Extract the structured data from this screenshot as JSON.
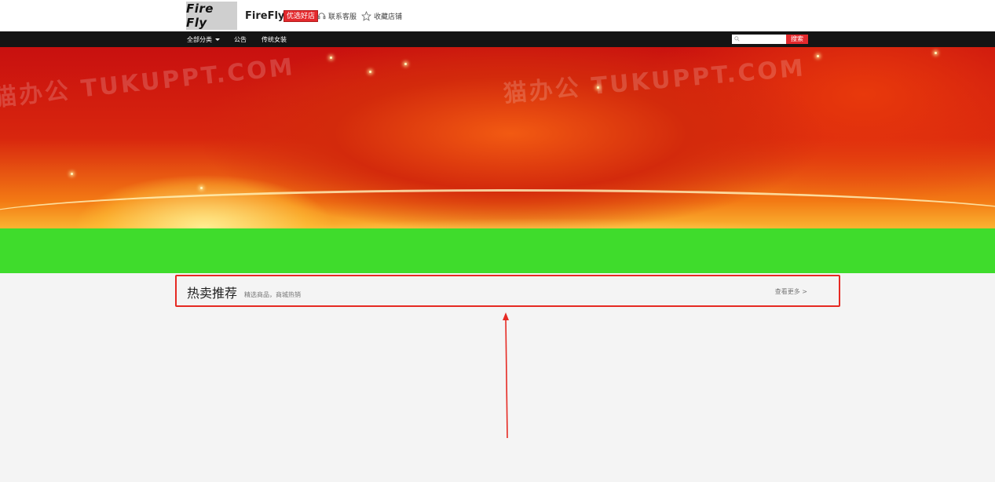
{
  "header": {
    "logo_text": "Fire Fly",
    "store_name": "FireFly",
    "badge": "优选好店",
    "contact_label": "联系客服",
    "favorite_label": "收藏店铺"
  },
  "nav": {
    "items": [
      {
        "label": "全部分类"
      },
      {
        "label": "公告"
      },
      {
        "label": "传统女装"
      }
    ],
    "search_placeholder": "",
    "search_button": "搜索"
  },
  "banner": {
    "watermark_left": "猫办公 TUKUPPT.COM",
    "watermark_right": "猫办公 TUKUPPT.COM"
  },
  "hot_section": {
    "title": "热卖推荐",
    "subtitle": "精选商品，商城热销",
    "more_label": "查看更多 >"
  },
  "colors": {
    "accent_red": "#e4292d",
    "nav_bg": "#141414",
    "green_band": "#3fdc2c",
    "page_bg": "#f4f4f4"
  }
}
